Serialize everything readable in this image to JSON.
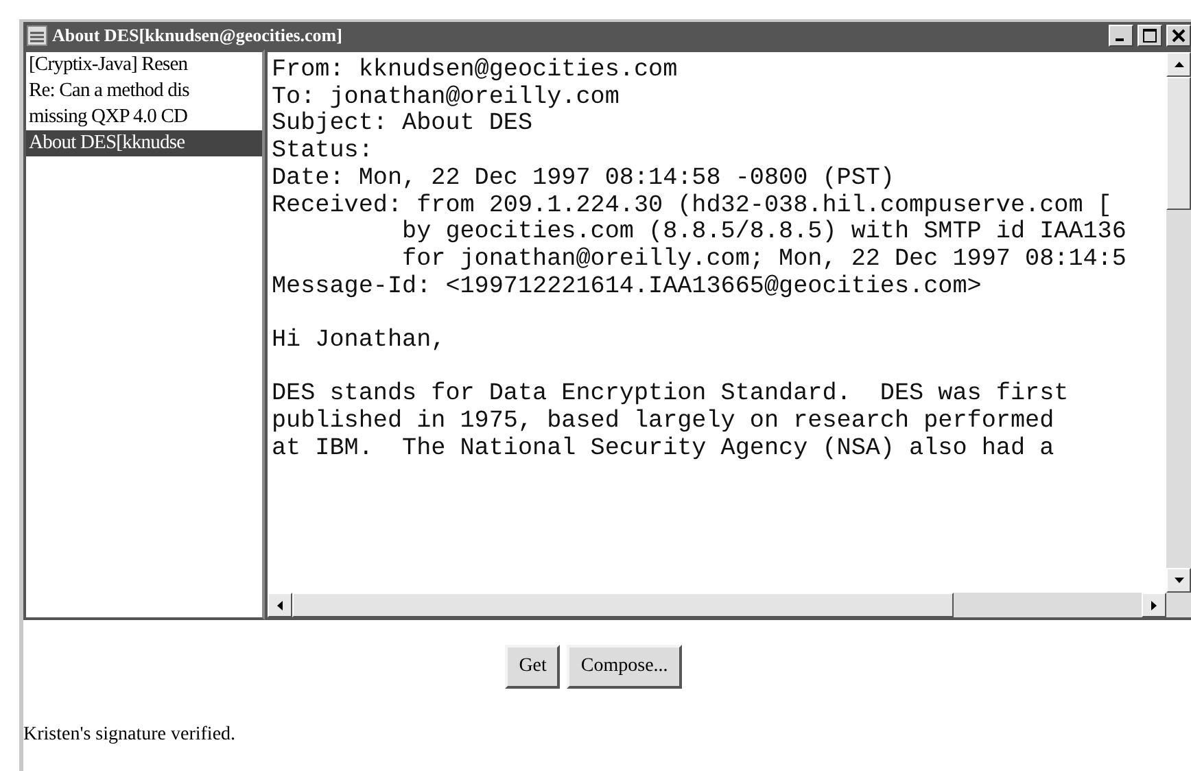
{
  "window": {
    "title": "About DES[kknudsen@geocities.com]"
  },
  "messages": [
    {
      "subject": "[Cryptix-Java] Resen",
      "selected": false
    },
    {
      "subject": "Re: Can a method dis",
      "selected": false
    },
    {
      "subject": "missing QXP 4.0 CD",
      "selected": false
    },
    {
      "subject": "About DES[kknudse",
      "selected": true
    }
  ],
  "message_body": [
    [
      "From: kknudsen@geocities.com",
      "To: jonathan@oreilly.com",
      "Subject: About DES",
      "Status:",
      "Date: Mon, 22 Dec 1997 08:14:58 -0800 (PST)",
      "Received: from 209.1.224.30 (hd32-038.hil.compuserve.com [",
      "         by geocities.com (8.8.5/8.8.5) with SMTP id IAA136",
      "         for jonathan@oreilly.com; Mon, 22 Dec 1997 08:14:5",
      "Message-Id: <199712221614.IAA13665@geocities.com>"
    ],
    [
      "Hi Jonathan,"
    ],
    [
      "DES stands for Data Encryption Standard.  DES was first",
      "published in 1975, based largely on research performed",
      "at IBM.  The National Security Agency (NSA) also had a"
    ]
  ],
  "buttons": [
    "Get",
    "Compose..."
  ],
  "status_bar": "Kristen's signature verified."
}
